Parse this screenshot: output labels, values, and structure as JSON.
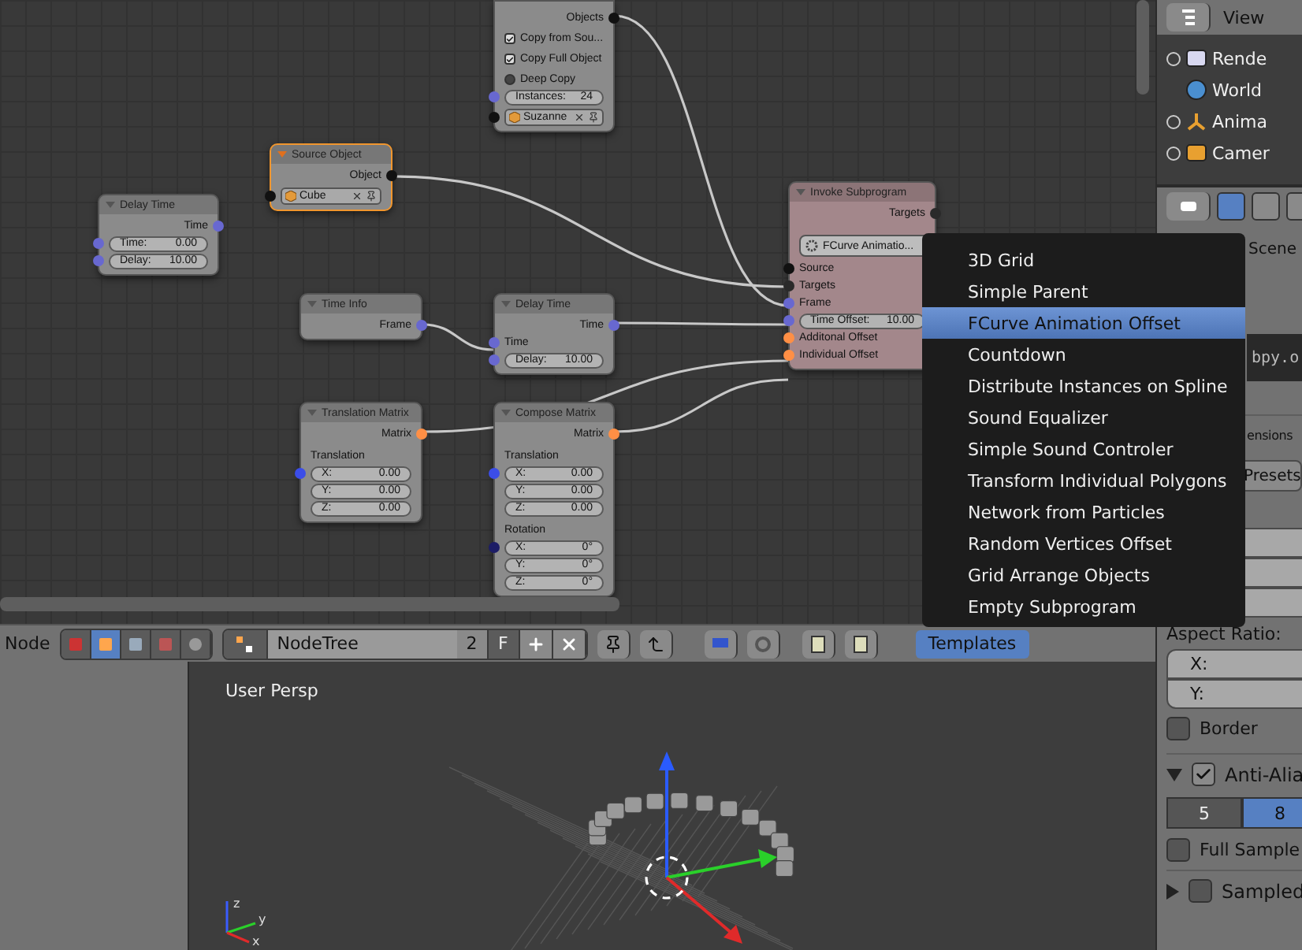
{
  "node_editor": {
    "nodes": [
      {
        "selected": false,
        "color": "#8b8b8b",
        "rows": [
          {
            "kind": "output",
            "label": "Objects",
            "color": "#111111"
          },
          {
            "kind": "checkbox",
            "label": "Copy from Sou...",
            "checked": true
          },
          {
            "kind": "checkbox",
            "label": "Copy Full Object",
            "checked": true
          },
          {
            "kind": "checkbox",
            "label": "Deep Copy",
            "checked": false
          },
          {
            "kind": "number",
            "label": "Instances:",
            "value": "24",
            "color": "#6868d0"
          },
          {
            "kind": "object",
            "value": "Suzanne",
            "color": "#111111"
          }
        ]
      },
      {
        "title": "Delay Time",
        "selected": false,
        "color": "#8b8b8b",
        "rows": [
          {
            "kind": "output",
            "label": "Time",
            "color": "#6868d0"
          },
          {
            "kind": "number",
            "label": "Time:",
            "value": "0.00",
            "color": "#6868d0"
          },
          {
            "kind": "number",
            "label": "Delay:",
            "value": "10.00",
            "color": "#6868d0"
          }
        ]
      },
      {
        "title": "Source Object",
        "selected": true,
        "color": "#8b8b8b",
        "rows": [
          {
            "kind": "output",
            "label": "Object",
            "color": "#111111"
          },
          {
            "kind": "object",
            "value": "Cube",
            "color": "#111111"
          }
        ]
      },
      {
        "title": "Time Info",
        "selected": false,
        "color": "#8b8b8b",
        "rows": [
          {
            "kind": "output",
            "label": "Frame",
            "color": "#6868d0"
          }
        ]
      },
      {
        "title": "Delay Time",
        "selected": false,
        "color": "#8b8b8b",
        "rows": [
          {
            "kind": "output",
            "label": "Time",
            "color": "#6868d0"
          },
          {
            "kind": "input",
            "label": "Time",
            "color": "#6868d0"
          },
          {
            "kind": "number",
            "label": "Delay:",
            "value": "10.00",
            "color": "#6868d0"
          }
        ]
      },
      {
        "title": "Invoke Subprogram",
        "selected": false,
        "color": "#a3878b",
        "rows": [
          {
            "kind": "output",
            "label": "Targets",
            "color": "#2a2a2a"
          },
          {
            "kind": "dropdown",
            "value": "FCurve Animatio..."
          },
          {
            "kind": "input",
            "label": "Source",
            "color": "#111111"
          },
          {
            "kind": "input",
            "label": "Targets",
            "color": "#2a2a2a"
          },
          {
            "kind": "input",
            "label": "Frame",
            "color": "#6868d0"
          },
          {
            "kind": "number",
            "label": "Time Offset:",
            "value": "10.00",
            "color": "#6868d0"
          },
          {
            "kind": "input",
            "label": "Additonal Offset",
            "color": "#ff8f45"
          },
          {
            "kind": "input",
            "label": "Individual Offset",
            "color": "#ff8f45"
          }
        ]
      },
      {
        "title": "Translation Matrix",
        "selected": false,
        "color": "#8b8b8b",
        "rows": [
          {
            "kind": "output",
            "label": "Matrix",
            "color": "#ff8f45"
          },
          {
            "kind": "label",
            "label": "Translation"
          },
          {
            "kind": "number",
            "label": "X:",
            "value": "0.00",
            "color": "#3b4de8"
          },
          {
            "kind": "number",
            "label": "Y:",
            "value": "0.00"
          },
          {
            "kind": "number",
            "label": "Z:",
            "value": "0.00"
          }
        ]
      },
      {
        "title": "Compose Matrix",
        "selected": false,
        "color": "#8b8b8b",
        "rows": [
          {
            "kind": "output",
            "label": "Matrix",
            "color": "#ff8f45"
          },
          {
            "kind": "label",
            "label": "Translation"
          },
          {
            "kind": "number",
            "label": "X:",
            "value": "0.00",
            "color": "#3b4de8"
          },
          {
            "kind": "number",
            "label": "Y:",
            "value": "0.00"
          },
          {
            "kind": "number",
            "label": "Z:",
            "value": "0.00"
          },
          {
            "kind": "label",
            "label": "Rotation"
          },
          {
            "kind": "number",
            "label": "X:",
            "value": "0°",
            "color": "#1c1c66"
          },
          {
            "kind": "number",
            "label": "Y:",
            "value": "0°"
          },
          {
            "kind": "number",
            "label": "Z:",
            "value": "0°"
          }
        ]
      }
    ]
  },
  "header": {
    "editor_label": "Node",
    "tree_types": [
      {
        "selected": false
      },
      {
        "selected": true
      },
      {
        "selected": false
      },
      {
        "selected": false
      },
      {
        "selected": false
      }
    ],
    "tree_name": "NodeTree",
    "users": "2",
    "fake_user": "F",
    "templates": {
      "label": "Templates",
      "open": true
    }
  },
  "template_menu": {
    "items": [
      {
        "label": "3D Grid",
        "selected": false
      },
      {
        "label": "Simple Parent",
        "selected": false
      },
      {
        "label": "FCurve Animation Offset",
        "selected": true
      },
      {
        "label": "Countdown",
        "selected": false
      },
      {
        "label": "Distribute Instances on Spline",
        "selected": false
      },
      {
        "label": "Sound Equalizer",
        "selected": false
      },
      {
        "label": "Simple Sound Controler",
        "selected": false
      },
      {
        "label": "Transform Individual Polygons",
        "selected": false
      },
      {
        "label": "Network from Particles",
        "selected": false
      },
      {
        "label": "Random Vertices Offset",
        "selected": false
      },
      {
        "label": "Grid Arrange Objects",
        "selected": false
      },
      {
        "label": "Empty Subprogram",
        "selected": false
      }
    ]
  },
  "viewport": {
    "label": "User Persp",
    "axes": [
      "z",
      "y",
      "x"
    ]
  },
  "outliner": {
    "view_label": "View",
    "items": [
      {
        "label": "Rende",
        "expandable": true
      },
      {
        "label": "World",
        "expandable": false
      },
      {
        "label": "Anima",
        "expandable": true
      },
      {
        "label": "Camer",
        "expandable": true
      }
    ]
  },
  "properties": {
    "tabs": [
      {
        "selected": true
      },
      {
        "selected": false
      },
      {
        "selected": false
      }
    ],
    "context": "Scene",
    "tooltip": "bpy.o",
    "dimensions": {
      "title": "ensions",
      "presets": "Presets",
      "aspect_label": "Aspect Ratio:",
      "aspect_fields": [
        "X:",
        "Y:"
      ],
      "border": {
        "label": "Border",
        "checked": false
      }
    },
    "anti_aliasing": {
      "title": "Anti-Alia",
      "expanded": true,
      "enabled": true,
      "samples": [
        {
          "label": "5",
          "selected": false
        },
        {
          "label": "8",
          "selected": true
        }
      ],
      "full_sample": {
        "label": "Full Sample",
        "checked": false
      }
    },
    "sampled": {
      "title": "Sampled",
      "expanded": false,
      "enabled": false
    }
  }
}
